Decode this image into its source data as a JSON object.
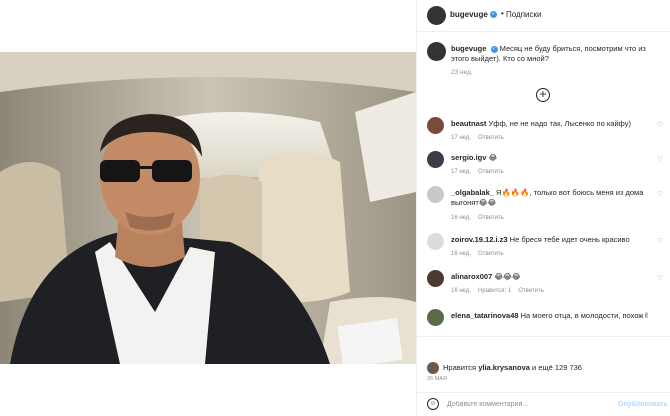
{
  "post": {
    "author": "bugevuge",
    "separator": "•",
    "follow_label": "Подписки",
    "caption_text": "Месяц не буду бриться, посмотрим что из этого выйдет). Кто со мной?",
    "caption_time": "23 нед.",
    "load_more": "+",
    "likes_prefix": "Нравится",
    "likes_user": "ylia.krysanova",
    "likes_suffix": "и ещё 129 736",
    "date": "26 МАЯ",
    "add_comment_placeholder": "Добавьте комментарий...",
    "publish_label": "Опубликовать",
    "verified_mark": "✓",
    "smile_glyph": "☺",
    "heart_glyph": "♡"
  },
  "comments": [
    {
      "user": "beautnast",
      "text": "Уфф, не не надо так, Лысенко по кайфу)",
      "time": "17 нед.",
      "reply": "Ответить",
      "likes": ""
    },
    {
      "user": "sergio.igv",
      "text": "😂",
      "time": "17 нед.",
      "reply": "Ответить",
      "likes": ""
    },
    {
      "user": "_olgabalak_",
      "text": "Я🔥🔥🔥, только вот боюсь меня из дома выгонят😂😂",
      "time": "16 нед.",
      "reply": "Ответить",
      "likes": ""
    },
    {
      "user": "zoirov.19.12.i.z3",
      "text": "Не бреся тебе идет очень красиво",
      "time": "16 нед.",
      "reply": "Ответить",
      "likes": ""
    },
    {
      "user": "alinarox007",
      "text": "😂😂😂",
      "time": "16 нед.",
      "reply": "Ответить",
      "likes": "Нравится: 1"
    },
    {
      "user": "elena_tatarinova48",
      "text": "На моего отца, в молодости, похож✌",
      "time": "",
      "reply": "",
      "likes": ""
    }
  ],
  "colors": {
    "link": "#3897f0",
    "muted": "#8e8e8e",
    "border": "#efefef",
    "text": "#262626"
  }
}
